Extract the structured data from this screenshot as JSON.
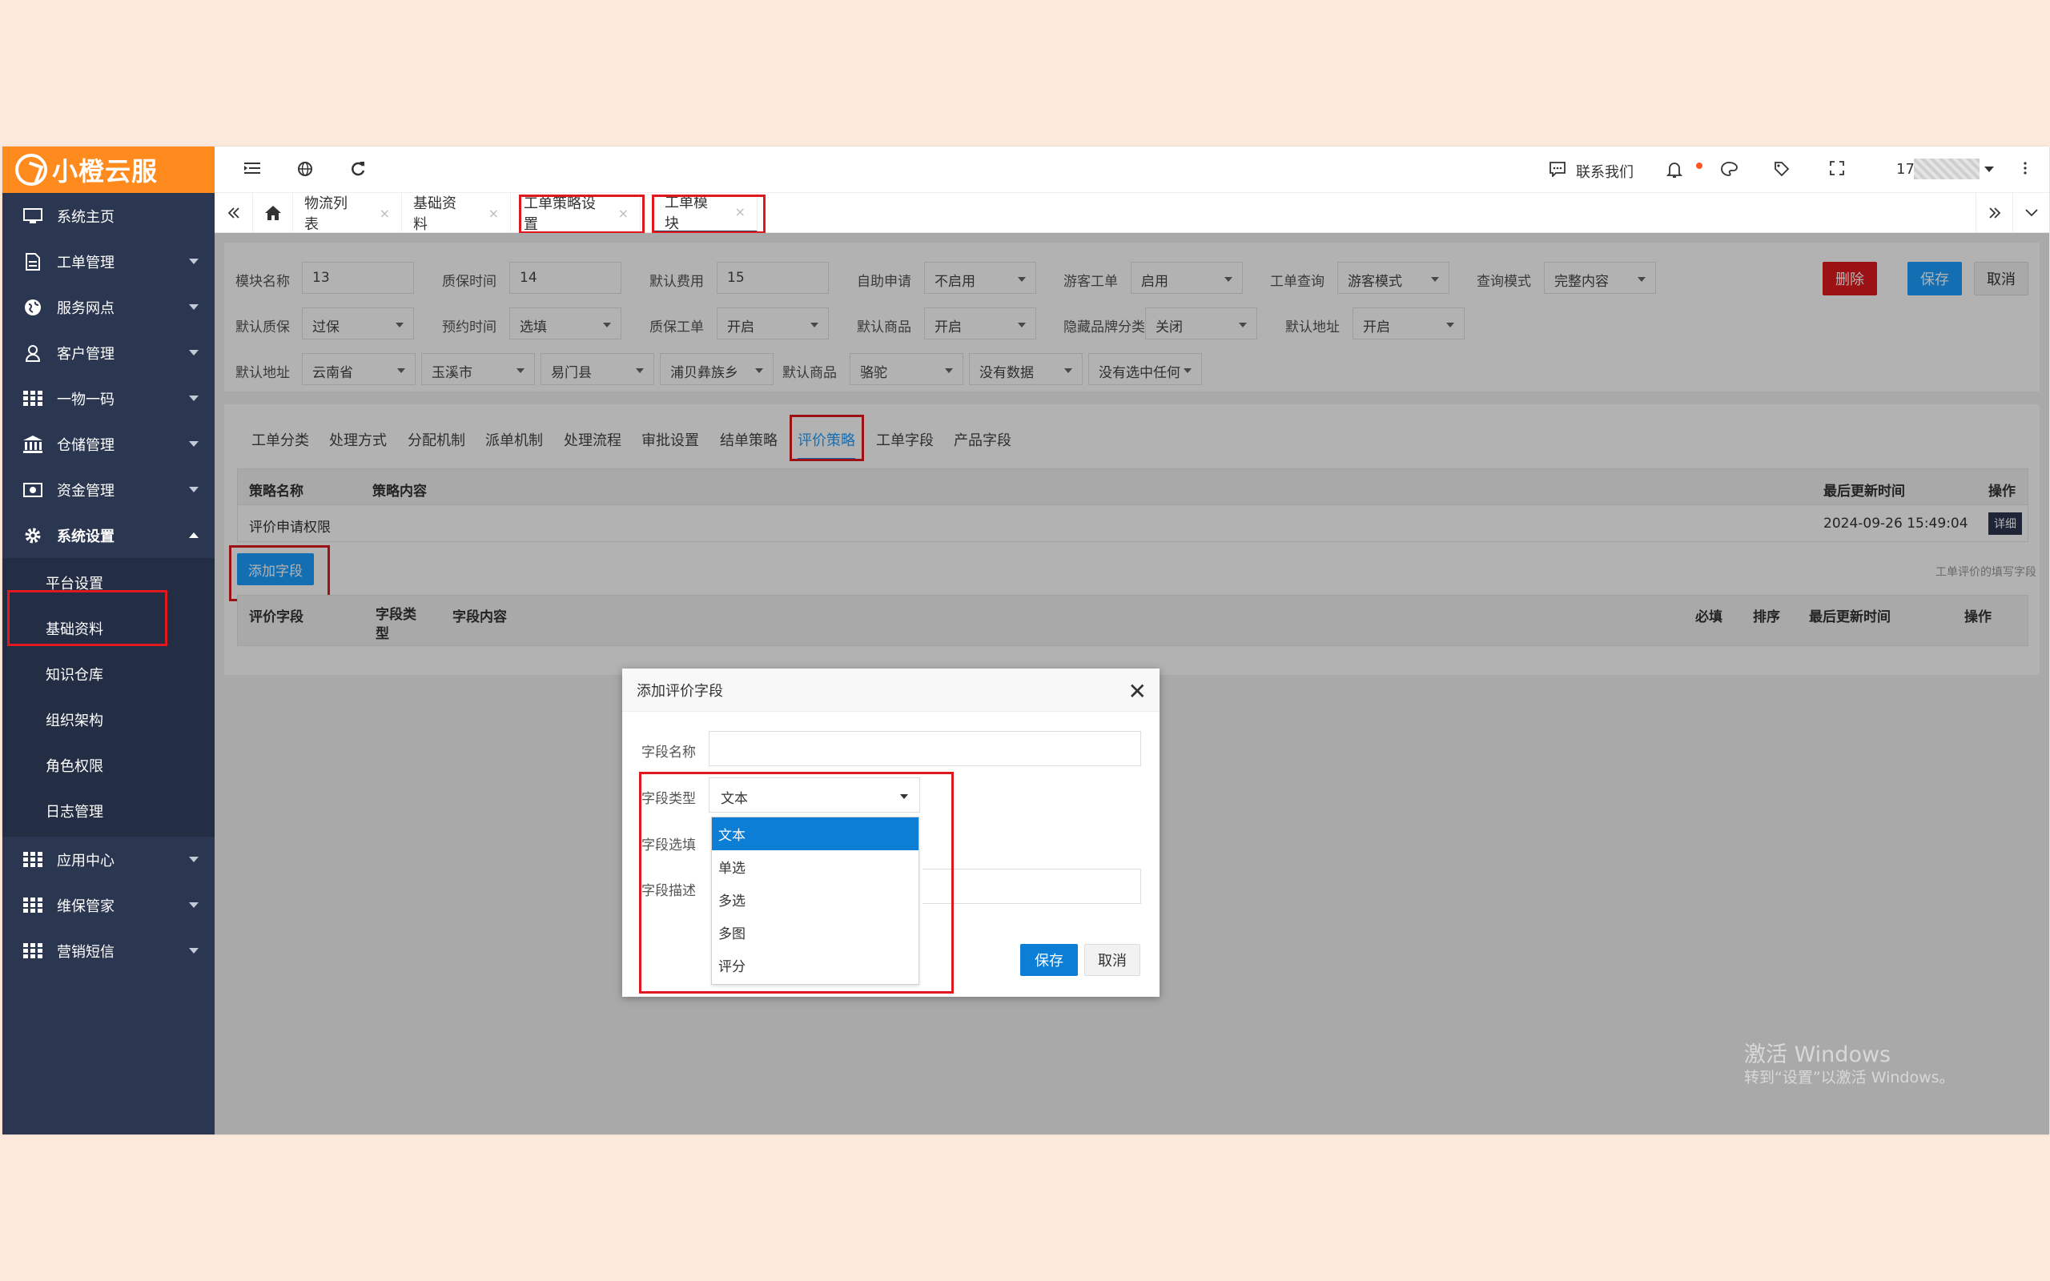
{
  "brand": "小橙云服",
  "sidebar": {
    "items": [
      {
        "label": "系统主页"
      },
      {
        "label": "工单管理"
      },
      {
        "label": "服务网点"
      },
      {
        "label": "客户管理"
      },
      {
        "label": "一物一码"
      },
      {
        "label": "仓储管理"
      },
      {
        "label": "资金管理"
      },
      {
        "label": "系统设置"
      }
    ],
    "sub_items": [
      {
        "label": "平台设置"
      },
      {
        "label": "基础资料"
      },
      {
        "label": "知识仓库"
      },
      {
        "label": "组织架构"
      },
      {
        "label": "角色权限"
      },
      {
        "label": "日志管理"
      }
    ],
    "bottom_items": [
      {
        "label": "应用中心"
      },
      {
        "label": "维保管家"
      },
      {
        "label": "营销短信"
      }
    ]
  },
  "topbar": {
    "contact": "联系我们",
    "user": "17"
  },
  "tabs": [
    {
      "label": "物流列表"
    },
    {
      "label": "基础资料"
    },
    {
      "label": "工单策略设置"
    },
    {
      "label": "工单模块"
    }
  ],
  "form": {
    "module_name_label": "模块名称",
    "module_name": "13",
    "warranty_time_label": "质保时间",
    "warranty_time": "14",
    "default_fee_label": "默认费用",
    "default_fee": "15",
    "self_apply_label": "自助申请",
    "self_apply": "不启用",
    "guest_order_label": "游客工单",
    "guest_order": "启用",
    "order_query_label": "工单查询",
    "order_query": "游客模式",
    "query_mode_label": "查询模式",
    "query_mode": "完整内容",
    "default_warranty_label": "默认质保",
    "default_warranty": "过保",
    "appt_time_label": "预约时间",
    "appt_time": "选填",
    "warranty_order_label": "质保工单",
    "warranty_order": "开启",
    "default_goods_label": "默认商品",
    "default_goods": "开启",
    "hide_brand_label": "隐藏品牌分类",
    "hide_brand": "关闭",
    "default_addr_label": "默认地址",
    "default_addr": "开启",
    "default_addr2_label": "默认地址",
    "province": "云南省",
    "city": "玉溪市",
    "county": "易门县",
    "town": "浦贝彝族乡",
    "default_goods2_label": "默认商品",
    "goods2": "骆驼",
    "goods3": "没有数据",
    "goods4": "没有选中任何",
    "delete_btn": "删除",
    "save_btn": "保存",
    "cancel_btn": "取消"
  },
  "subtabs": [
    {
      "label": "工单分类"
    },
    {
      "label": "处理方式"
    },
    {
      "label": "分配机制"
    },
    {
      "label": "派单机制"
    },
    {
      "label": "处理流程"
    },
    {
      "label": "审批设置"
    },
    {
      "label": "结单策略"
    },
    {
      "label": "评价策略"
    },
    {
      "label": "工单字段"
    },
    {
      "label": "产品字段"
    }
  ],
  "strategy_table": {
    "headers": [
      "策略名称",
      "策略内容",
      "最后更新时间",
      "操作"
    ],
    "row": {
      "name": "评价申请权限",
      "content": "",
      "updated": "2024-09-26 15:49:04",
      "action": "详细"
    }
  },
  "add_field_btn": "添加字段",
  "field_hint": "工单评价的填写字段",
  "field_table": {
    "headers": [
      "评价字段",
      "字段类型",
      "字段内容",
      "必填",
      "排序",
      "最后更新时间",
      "操作"
    ]
  },
  "modal": {
    "title": "添加评价字段",
    "name_label": "字段名称",
    "type_label": "字段类型",
    "type_value": "文本",
    "options_label": "字段选填",
    "desc_label": "字段描述",
    "type_options": [
      "文本",
      "单选",
      "多选",
      "多图",
      "评分"
    ],
    "save": "保存",
    "cancel": "取消"
  },
  "watermark": {
    "line1": "激活 Windows",
    "line2": "转到“设置”以激活 Windows。"
  },
  "colors": {
    "brand": "#ff8a1e",
    "sidebar": "#2b3650",
    "primary": "#1e9fff",
    "danger": "#e0191e",
    "selected": "#0c7ed6"
  }
}
